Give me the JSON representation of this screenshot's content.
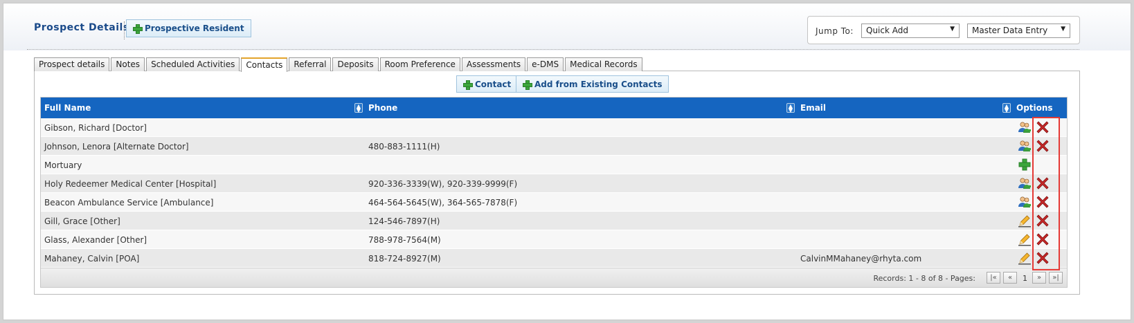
{
  "header": {
    "title": "Prospect Details",
    "prospective_resident_label": "Prospective Resident",
    "jump_to_label": "Jump To:",
    "jump_select_value": "Quick Add",
    "entry_select_value": "Master Data Entry"
  },
  "tabs": [
    {
      "label": "Prospect details",
      "active": false
    },
    {
      "label": "Notes",
      "active": false
    },
    {
      "label": "Scheduled Activities",
      "active": false
    },
    {
      "label": "Contacts",
      "active": true
    },
    {
      "label": "Referral",
      "active": false
    },
    {
      "label": "Deposits",
      "active": false
    },
    {
      "label": "Room Preference",
      "active": false
    },
    {
      "label": "Assessments",
      "active": false
    },
    {
      "label": "e-DMS",
      "active": false
    },
    {
      "label": "Medical Records",
      "active": false
    }
  ],
  "actions": {
    "contact_label": "Contact",
    "add_existing_label": "Add from Existing Contacts"
  },
  "table": {
    "columns": [
      "Full Name",
      "Phone",
      "Email",
      "Options"
    ],
    "rows": [
      {
        "name": "Gibson, Richard [Doctor]",
        "phone": "",
        "email": "",
        "option_icon": "contacts-icon",
        "delete": true
      },
      {
        "name": "Johnson, Lenora [Alternate Doctor]",
        "phone": "480-883-1111(H)",
        "email": "",
        "option_icon": "contacts-icon",
        "delete": true
      },
      {
        "name": "Mortuary",
        "phone": "",
        "email": "",
        "option_icon": "add-icon",
        "delete": false
      },
      {
        "name": "Holy Redeemer Medical Center [Hospital]",
        "phone": "920-336-3339(W), 920-339-9999(F)",
        "email": "",
        "option_icon": "contacts-icon",
        "delete": true
      },
      {
        "name": "Beacon Ambulance Service [Ambulance]",
        "phone": "464-564-5645(W), 364-565-7878(F)",
        "email": "",
        "option_icon": "contacts-icon",
        "delete": true
      },
      {
        "name": "Gill, Grace [Other]",
        "phone": "124-546-7897(H)",
        "email": "",
        "option_icon": "pencil-icon",
        "delete": true
      },
      {
        "name": "Glass, Alexander [Other]",
        "phone": "788-978-7564(M)",
        "email": "",
        "option_icon": "pencil-icon",
        "delete": true
      },
      {
        "name": "Mahaney, Calvin [POA]",
        "phone": "818-724-8927(M)",
        "email": "CalvinMMahaney@rhyta.com",
        "option_icon": "pencil-icon",
        "delete": true
      }
    ]
  },
  "pager": {
    "records_text": "Records: 1 - 8 of 8 - Pages:",
    "current_page": "1"
  },
  "colors": {
    "header_blue": "#1565c0",
    "highlight_red": "#e53935",
    "delete_red": "#b71c1c",
    "plus_green": "#3ca63c"
  }
}
